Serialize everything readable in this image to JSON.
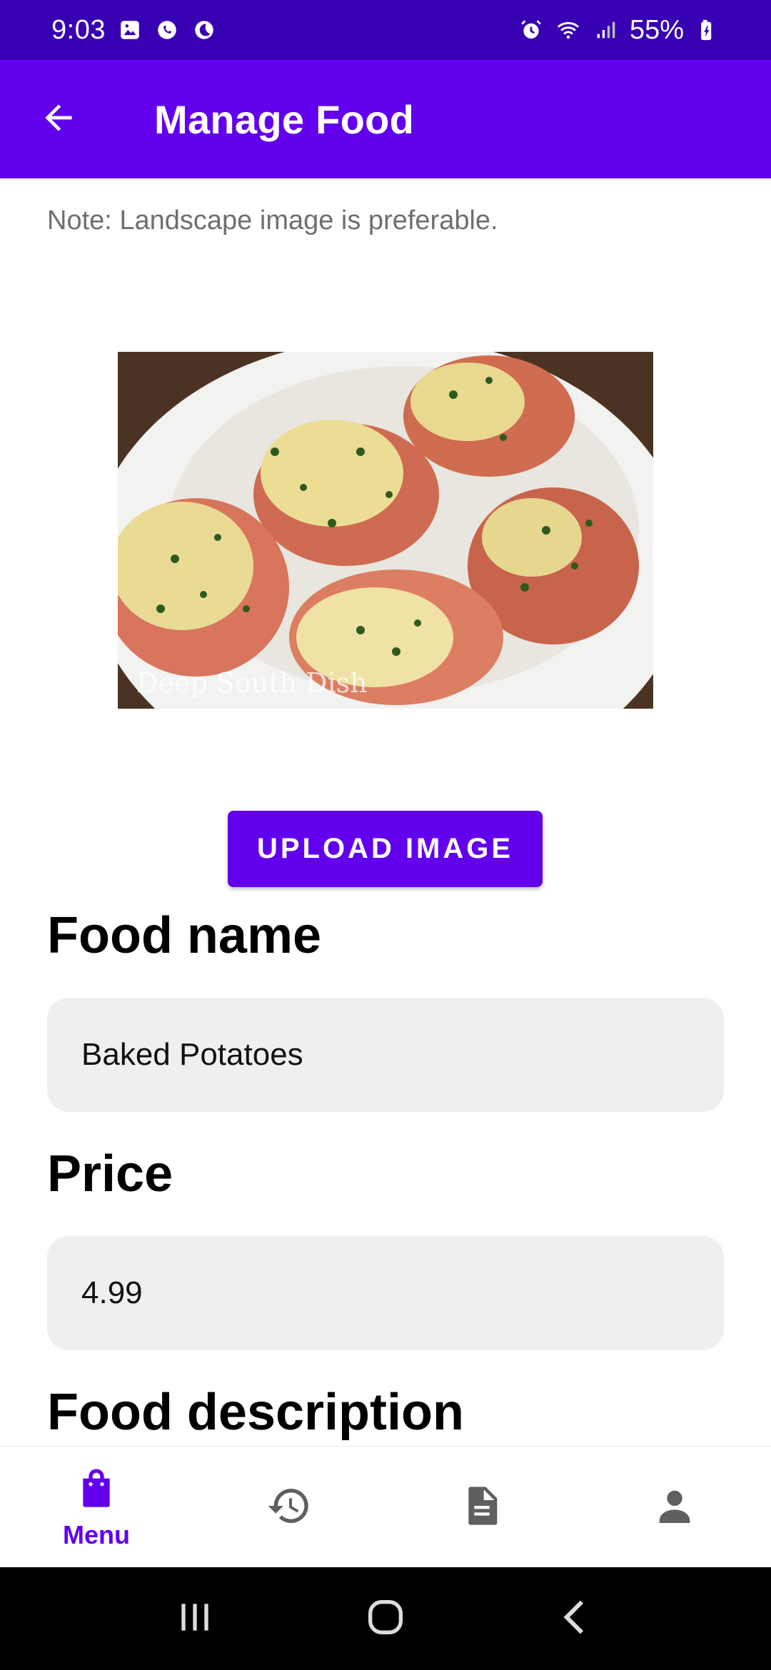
{
  "status_bar": {
    "time": "9:03",
    "battery": "55%",
    "left_icons": [
      "image-notification-icon",
      "whatsapp-icon",
      "do-not-disturb-icon"
    ],
    "right_icons": [
      "alarm-icon",
      "wifi-icon",
      "signal-icon",
      "battery-icon"
    ]
  },
  "app_bar": {
    "title": "Manage Food",
    "back_icon": "arrow-back-icon"
  },
  "note": "Note: Landscape image is preferable.",
  "image": {
    "watermark": "Deep South Dish"
  },
  "upload_button": "UPLOAD IMAGE",
  "fields": {
    "food_name_label": "Food name",
    "food_name_value": "Baked Potatoes",
    "price_label": "Price",
    "price_value": "4.99",
    "description_label": "Food description"
  },
  "bottom_nav": {
    "items": [
      {
        "icon": "shopping-bag-icon",
        "label": "Menu",
        "active": true
      },
      {
        "icon": "history-icon",
        "label": "",
        "active": false
      },
      {
        "icon": "document-icon",
        "label": "",
        "active": false
      },
      {
        "icon": "person-icon",
        "label": "",
        "active": false
      }
    ]
  },
  "colors": {
    "status_bar": "#3700b3",
    "primary": "#6200ee",
    "field_bg": "#efefef",
    "nav_inactive": "#5f5f5f"
  }
}
